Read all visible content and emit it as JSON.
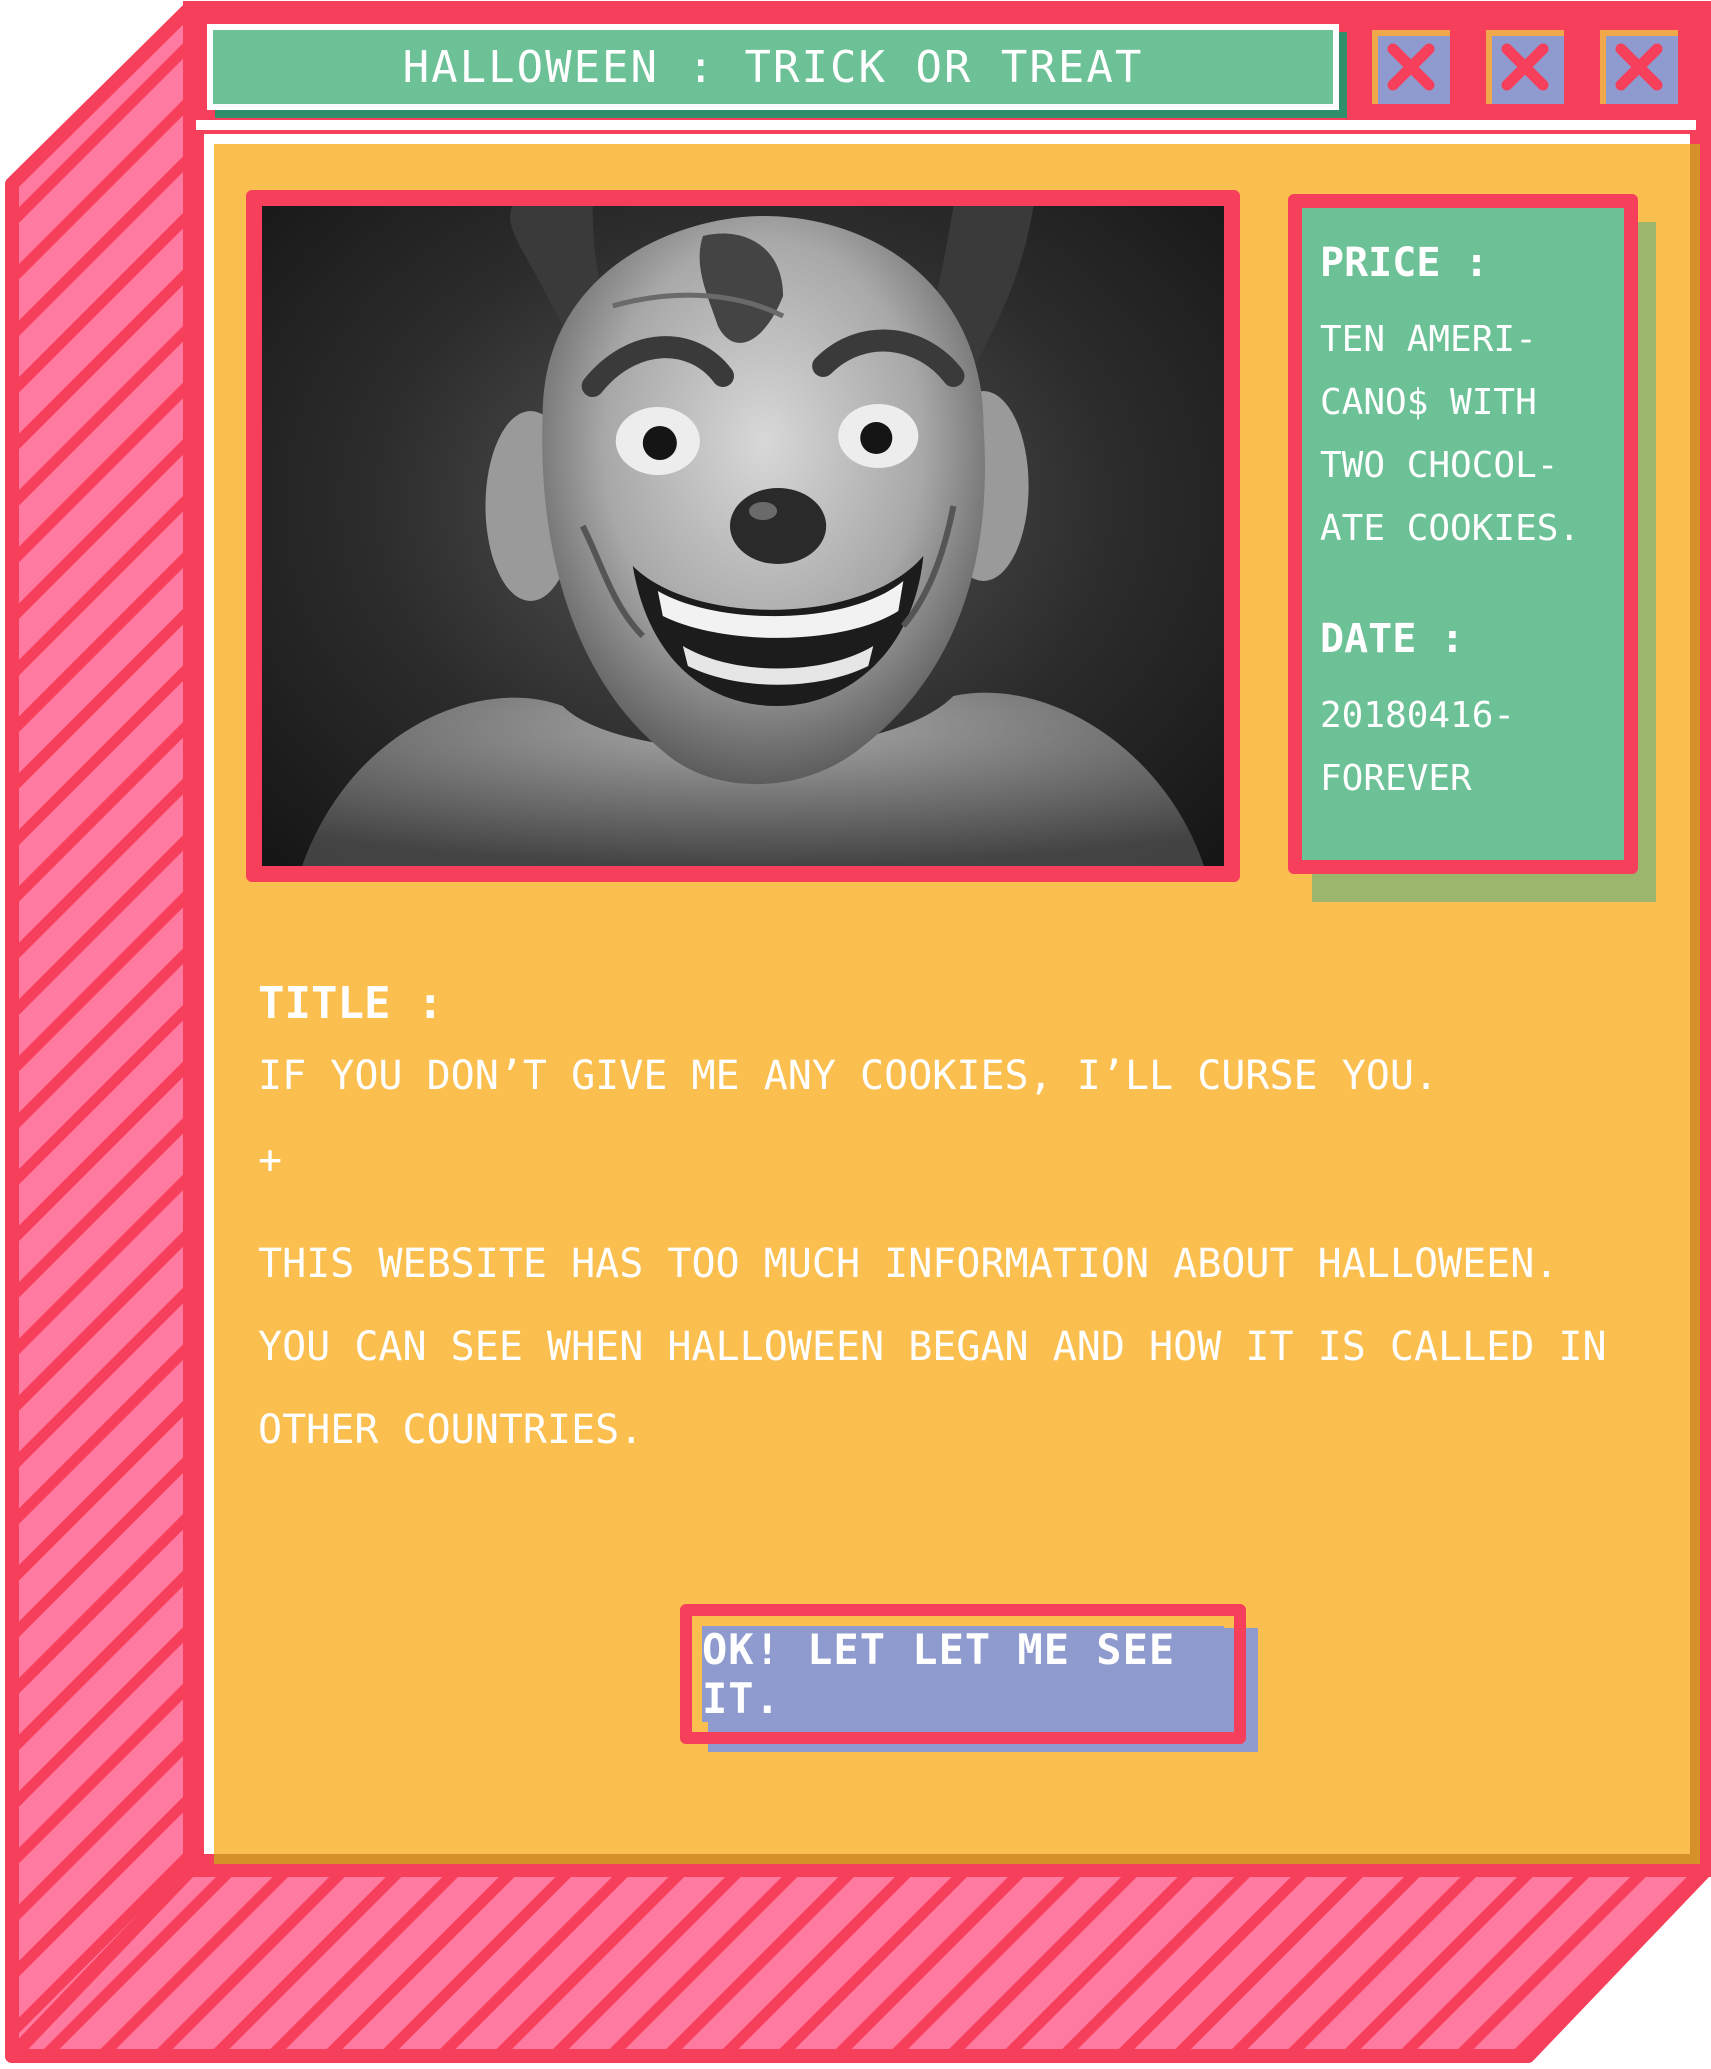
{
  "window": {
    "title": "HALLOWEEN : TRICK OR TREAT",
    "close_buttons": [
      "close-icon",
      "close-icon",
      "close-icon"
    ]
  },
  "info": {
    "price_label": "PRICE :",
    "price_value": "TEN AMERI-\nCANO$ WITH\nTWO CHOCOL-\nATE COOKIES.",
    "date_label": "DATE :",
    "date_value": "20180416-\nFOREVER"
  },
  "content": {
    "title_label": "TITLE :",
    "title_value": "IF YOU DON’T GIVE ME ANY COOKIES, I’LL CURSE YOU.",
    "separator": "+",
    "description": "THIS WEBSITE HAS TOO MUCH INFORMATION ABOUT HALLOWEEN. YOU CAN SEE WHEN HALLOWEEN BEGAN AND HOW IT IS CALLED IN OTHER COUNTRIES."
  },
  "cta": {
    "label": "OK! LET LET ME SEE IT."
  },
  "colors": {
    "frame": "#f63f5b",
    "stripe": "#ff7aa0",
    "panel": "#fbbf50",
    "title_bar": "#6cc196",
    "button": "#8f9bcf"
  }
}
